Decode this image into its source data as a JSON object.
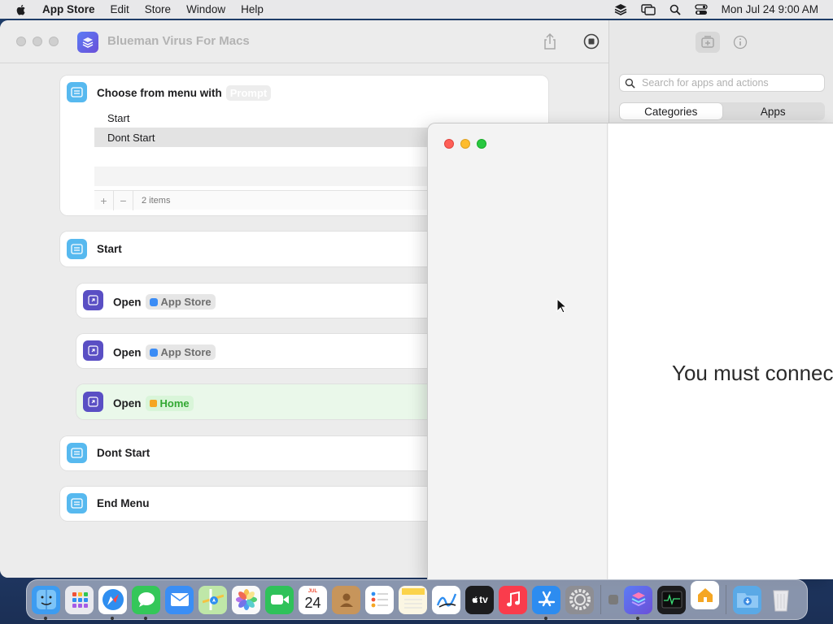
{
  "menubar": {
    "app_name": "App Store",
    "items": [
      "Edit",
      "Store",
      "Window",
      "Help"
    ],
    "clock": "Mon Jul 24  9:00 AM",
    "status_icons": [
      "layers-icon",
      "screen-mirroring-icon",
      "search-icon",
      "control-center-icon"
    ]
  },
  "shortcuts_window": {
    "title": "Blueman Virus For Macs",
    "sidebar": {
      "search_placeholder": "Search for apps and actions",
      "segments": [
        "Categories",
        "Apps"
      ],
      "active_segment": "Categories"
    },
    "actions": {
      "choose_menu": {
        "title": "Choose from menu with",
        "prompt_token": "Prompt",
        "items": [
          "Start",
          "Dont Start"
        ],
        "item_count": "2 items"
      },
      "start_case": "Start",
      "open1": {
        "verb": "Open",
        "app": "App Store"
      },
      "open2": {
        "verb": "Open",
        "app": "App Store"
      },
      "open3": {
        "verb": "Open",
        "app": "Home"
      },
      "dont_start_case": "Dont Start",
      "end_menu": "End Menu"
    }
  },
  "overlay_window": {
    "message": "You must connec"
  },
  "dock": {
    "items": [
      {
        "name": "Finder",
        "color": "#3d9cf0",
        "running": true
      },
      {
        "name": "Launchpad",
        "color": "#e6e6e6",
        "running": false
      },
      {
        "name": "Safari",
        "color": "#2f8ef0",
        "running": true
      },
      {
        "name": "Messages",
        "color": "#34c759",
        "running": true
      },
      {
        "name": "Mail",
        "color": "#3a8ef5",
        "running": false
      },
      {
        "name": "Maps",
        "color": "#5fbf5a",
        "running": false
      },
      {
        "name": "Photos",
        "color": "#f2f2f2",
        "running": false
      },
      {
        "name": "FaceTime",
        "color": "#2fc25a",
        "running": false
      },
      {
        "name": "Calendar",
        "color": "#ffffff",
        "running": false
      },
      {
        "name": "Contacts",
        "color": "#c7955b",
        "running": false
      },
      {
        "name": "Reminders",
        "color": "#ffffff",
        "running": false
      },
      {
        "name": "Notes",
        "color": "#fbe27a",
        "running": false
      },
      {
        "name": "Freeform",
        "color": "#ffffff",
        "running": false
      },
      {
        "name": "TV",
        "color": "#1c1c1e",
        "running": false
      },
      {
        "name": "Music",
        "color": "#fa3c4c",
        "running": false
      },
      {
        "name": "App Store",
        "color": "#2d8cf0",
        "running": true
      },
      {
        "name": "System Settings",
        "color": "#8e8e93",
        "running": false
      }
    ],
    "recent": [
      {
        "name": "Unknown",
        "color": "#7a7a7a",
        "running": false
      },
      {
        "name": "Shortcuts",
        "color": "#5a4fc4",
        "running": true
      },
      {
        "name": "Activity Monitor",
        "color": "#1c1c1e",
        "running": false
      },
      {
        "name": "Home",
        "color": "#ffffff",
        "running": false
      }
    ],
    "calendar_month": "JUL",
    "calendar_day": "24",
    "tv_label": "tv"
  }
}
